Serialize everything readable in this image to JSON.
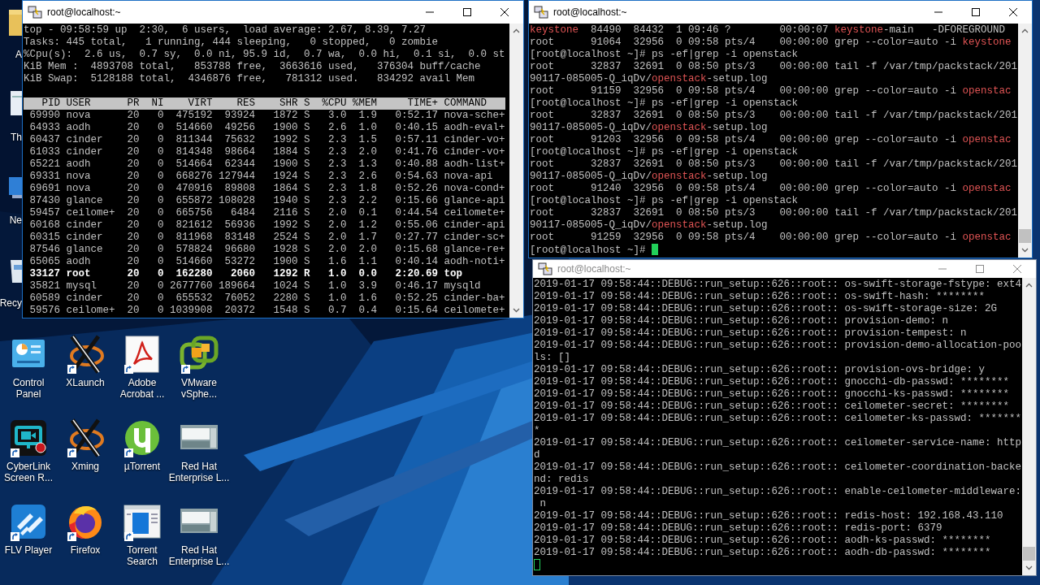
{
  "desktop": {
    "edge_icons": [
      {
        "kind": "folder",
        "label": "A"
      },
      {
        "kind": "document",
        "label": "Th"
      },
      {
        "kind": "network",
        "label": "Ne"
      },
      {
        "kind": "recycle-bin",
        "label": "Recy"
      }
    ],
    "shortcuts": [
      {
        "kind": "control-panel",
        "label": "Control\nPanel",
        "shortcut": false
      },
      {
        "kind": "x-logo",
        "label": "XLaunch",
        "shortcut": true
      },
      {
        "kind": "pdf",
        "label": "Adobe\nAcrobat ...",
        "shortcut": true
      },
      {
        "kind": "vmware",
        "label": "VMware\nvSphe...",
        "shortcut": true
      },
      {
        "kind": "screen-recorder",
        "label": "CyberLink\nScreen R...",
        "shortcut": true
      },
      {
        "kind": "x-logo",
        "label": "Xming",
        "shortcut": true
      },
      {
        "kind": "torrent",
        "label": "µTorrent",
        "shortcut": true
      },
      {
        "kind": "window-thumbnail",
        "label": "Red Hat\nEnterprise L...",
        "shortcut": false
      },
      {
        "kind": "tiles",
        "label": "FLV Player",
        "shortcut": true
      },
      {
        "kind": "firefox",
        "label": "Firefox",
        "shortcut": true
      },
      {
        "kind": "search-window",
        "label": "Torrent\nSearch",
        "shortcut": true
      },
      {
        "kind": "window-thumbnail",
        "label": "Red Hat\nEnterprise L...",
        "shortcut": false
      }
    ]
  },
  "windows": [
    {
      "kind": "top",
      "title": "root@localhost:~",
      "active": true,
      "summary": [
        "top - 09:58:59 up  2:30,  6 users,  load average: 2.67, 8.39, 7.27",
        "Tasks: 445 total,   1 running, 444 sleeping,   0 stopped,   0 zombie",
        "%Cpu(s):  2.6 us,  0.7 sy,  0.0 ni, 95.9 id,  0.7 wa,  0.0 hi,  0.1 si,  0.0 st",
        "KiB Mem :  4893708 total,   853788 free,  3663616 used,   376304 buff/cache",
        "KiB Swap:  5128188 total,  4346876 free,   781312 used.   834292 avail Mem"
      ],
      "columns": [
        "PID",
        "USER",
        "PR",
        "NI",
        "VIRT",
        "RES",
        "SHR",
        "S",
        "%CPU",
        "%MEM",
        "TIME+",
        "COMMAND"
      ],
      "rows": [
        {
          "cells": [
            "69990",
            "nova",
            "20",
            "0",
            "475192",
            "93924",
            "1872",
            "S",
            "3.0",
            "1.9",
            "0:52.17",
            "nova-sche+"
          ],
          "bold": false
        },
        {
          "cells": [
            "64933",
            "aodh",
            "20",
            "0",
            "514660",
            "49256",
            "1900",
            "S",
            "2.6",
            "1.0",
            "0:40.15",
            "aodh-eval+"
          ],
          "bold": false
        },
        {
          "cells": [
            "60437",
            "cinder",
            "20",
            "0",
            "811344",
            "75632",
            "1992",
            "S",
            "2.3",
            "1.5",
            "0:57.11",
            "cinder-vo+"
          ],
          "bold": false
        },
        {
          "cells": [
            "61033",
            "cinder",
            "20",
            "0",
            "814348",
            "98664",
            "1884",
            "S",
            "2.3",
            "2.0",
            "0:41.76",
            "cinder-vo+"
          ],
          "bold": false
        },
        {
          "cells": [
            "65221",
            "aodh",
            "20",
            "0",
            "514664",
            "62344",
            "1900",
            "S",
            "2.3",
            "1.3",
            "0:40.88",
            "aodh-list+"
          ],
          "bold": false
        },
        {
          "cells": [
            "69331",
            "nova",
            "20",
            "0",
            "668276",
            "127944",
            "1924",
            "S",
            "2.3",
            "2.6",
            "0:54.63",
            "nova-api"
          ],
          "bold": false
        },
        {
          "cells": [
            "69691",
            "nova",
            "20",
            "0",
            "470916",
            "89808",
            "1864",
            "S",
            "2.3",
            "1.8",
            "0:52.26",
            "nova-cond+"
          ],
          "bold": false
        },
        {
          "cells": [
            "87430",
            "glance",
            "20",
            "0",
            "655872",
            "108028",
            "1940",
            "S",
            "2.3",
            "2.2",
            "0:15.66",
            "glance-api"
          ],
          "bold": false
        },
        {
          "cells": [
            "59457",
            "ceilome+",
            "20",
            "0",
            "665756",
            "6484",
            "2116",
            "S",
            "2.0",
            "0.1",
            "0:44.54",
            "ceilomete+"
          ],
          "bold": false
        },
        {
          "cells": [
            "60168",
            "cinder",
            "20",
            "0",
            "821612",
            "56936",
            "1992",
            "S",
            "2.0",
            "1.2",
            "0:55.06",
            "cinder-api"
          ],
          "bold": false
        },
        {
          "cells": [
            "60315",
            "cinder",
            "20",
            "0",
            "811968",
            "83148",
            "2524",
            "S",
            "2.0",
            "1.7",
            "0:27.77",
            "cinder-sc+"
          ],
          "bold": false
        },
        {
          "cells": [
            "87546",
            "glance",
            "20",
            "0",
            "578824",
            "96680",
            "1928",
            "S",
            "2.0",
            "2.0",
            "0:15.68",
            "glance-re+"
          ],
          "bold": false
        },
        {
          "cells": [
            "65065",
            "aodh",
            "20",
            "0",
            "514660",
            "53272",
            "1900",
            "S",
            "1.6",
            "1.1",
            "0:40.14",
            "aodh-noti+"
          ],
          "bold": false
        },
        {
          "cells": [
            "33127",
            "root",
            "20",
            "0",
            "162280",
            "2060",
            "1292",
            "R",
            "1.0",
            "0.0",
            "2:20.69",
            "top"
          ],
          "bold": true
        },
        {
          "cells": [
            "35821",
            "mysql",
            "20",
            "0",
            "2677760",
            "189664",
            "1024",
            "S",
            "1.0",
            "3.9",
            "0:46.17",
            "mysqld"
          ],
          "bold": false
        },
        {
          "cells": [
            "60589",
            "cinder",
            "20",
            "0",
            "655532",
            "76052",
            "2280",
            "S",
            "1.0",
            "1.6",
            "0:52.25",
            "cinder-ba+"
          ],
          "bold": false
        },
        {
          "cells": [
            "59576",
            "ceilome+",
            "20",
            "0",
            "1039908",
            "20372",
            "1548",
            "S",
            "0.7",
            "0.4",
            "0:15.64",
            "ceilomete+"
          ],
          "bold": false
        }
      ]
    },
    {
      "kind": "log",
      "title": "root@localhost:~",
      "active": true,
      "lines": [
        {
          "segments": [
            {
              "text": "keystone",
              "match": true
            },
            {
              "text": "  84490  84432  1 09:46 ?        00:00:07 ",
              "match": false
            },
            {
              "text": "keystone",
              "match": true
            },
            {
              "text": "-main   -DFOREGROUND",
              "match": false
            }
          ]
        },
        {
          "segments": [
            {
              "text": "root      91064  32956  0 09:58 pts/4    00:00:00 grep --color=auto -i ",
              "match": false
            },
            {
              "text": "keystone",
              "match": true
            }
          ]
        },
        "[root@localhost ~]# ps -ef|grep -i openstack",
        "root      32837  32691  0 08:50 pts/3    00:00:00 tail -f /var/tmp/packstack/201",
        {
          "segments": [
            {
              "text": "90117-085005-Q_iqDv/",
              "match": false
            },
            {
              "text": "openstack",
              "match": true
            },
            {
              "text": "-setup.log",
              "match": false
            }
          ]
        },
        {
          "segments": [
            {
              "text": "root      91159  32956  0 09:58 pts/4    00:00:00 grep --color=auto -i ",
              "match": false
            },
            {
              "text": "openstac",
              "match": true
            }
          ]
        },
        "[root@localhost ~]# ps -ef|grep -i openstack",
        "root      32837  32691  0 08:50 pts/3    00:00:00 tail -f /var/tmp/packstack/201",
        {
          "segments": [
            {
              "text": "90117-085005-Q_iqDv/",
              "match": false
            },
            {
              "text": "openstack",
              "match": true
            },
            {
              "text": "-setup.log",
              "match": false
            }
          ]
        },
        {
          "segments": [
            {
              "text": "root      91203  32956  0 09:58 pts/4    00:00:00 grep --color=auto -i ",
              "match": false
            },
            {
              "text": "openstac",
              "match": true
            }
          ]
        },
        "[root@localhost ~]# ps -ef|grep -i openstack",
        "root      32837  32691  0 08:50 pts/3    00:00:00 tail -f /var/tmp/packstack/201",
        {
          "segments": [
            {
              "text": "90117-085005-Q_iqDv/",
              "match": false
            },
            {
              "text": "openstack",
              "match": true
            },
            {
              "text": "-setup.log",
              "match": false
            }
          ]
        },
        {
          "segments": [
            {
              "text": "root      91240  32956  0 09:58 pts/4    00:00:00 grep --color=auto -i ",
              "match": false
            },
            {
              "text": "openstac",
              "match": true
            }
          ]
        },
        "[root@localhost ~]# ps -ef|grep -i openstack",
        "root      32837  32691  0 08:50 pts/3    00:00:00 tail -f /var/tmp/packstack/201",
        {
          "segments": [
            {
              "text": "90117-085005-Q_iqDv/",
              "match": false
            },
            {
              "text": "openstack",
              "match": true
            },
            {
              "text": "-setup.log",
              "match": false
            }
          ]
        },
        {
          "segments": [
            {
              "text": "root      91259  32956  0 09:58 pts/4    00:00:00 grep --color=auto -i ",
              "match": false
            },
            {
              "text": "openstac",
              "match": true
            }
          ]
        },
        {
          "segments": [
            {
              "text": "[root@localhost ~]# ",
              "match": false
            }
          ],
          "cursor": true,
          "cursor_filled": true
        }
      ]
    },
    {
      "kind": "log",
      "title": "root@localhost:~",
      "active": false,
      "lines": [
        "2019-01-17 09:58:44::DEBUG::run_setup::626::root:: os-swift-storage-fstype: ext4",
        "2019-01-17 09:58:44::DEBUG::run_setup::626::root:: os-swift-hash: ********",
        "2019-01-17 09:58:44::DEBUG::run_setup::626::root:: os-swift-storage-size: 2G",
        "2019-01-17 09:58:44::DEBUG::run_setup::626::root:: provision-demo: n",
        "2019-01-17 09:58:44::DEBUG::run_setup::626::root:: provision-tempest: n",
        "2019-01-17 09:58:44::DEBUG::run_setup::626::root:: provision-demo-allocation-poo",
        "ls: []",
        "2019-01-17 09:58:44::DEBUG::run_setup::626::root:: provision-ovs-bridge: y",
        "2019-01-17 09:58:44::DEBUG::run_setup::626::root:: gnocchi-db-passwd: ********",
        "2019-01-17 09:58:44::DEBUG::run_setup::626::root:: gnocchi-ks-passwd: ********",
        "2019-01-17 09:58:44::DEBUG::run_setup::626::root:: ceilometer-secret: ********",
        "2019-01-17 09:58:44::DEBUG::run_setup::626::root:: ceilometer-ks-passwd: *******",
        "*",
        "2019-01-17 09:58:44::DEBUG::run_setup::626::root:: ceilometer-service-name: http",
        "d",
        "2019-01-17 09:58:44::DEBUG::run_setup::626::root:: ceilometer-coordination-backe",
        "nd: redis",
        "2019-01-17 09:58:44::DEBUG::run_setup::626::root:: enable-ceilometer-middleware:",
        " n",
        "2019-01-17 09:58:44::DEBUG::run_setup::626::root:: redis-host: 192.168.43.110",
        "2019-01-17 09:58:44::DEBUG::run_setup::626::root:: redis-port: 6379",
        "2019-01-17 09:58:44::DEBUG::run_setup::626::root:: aodh-ks-passwd: ********",
        "2019-01-17 09:58:44::DEBUG::run_setup::626::root:: aodh-db-passwd: ********",
        {
          "cursor": true,
          "cursor_filled": false
        }
      ]
    }
  ]
}
